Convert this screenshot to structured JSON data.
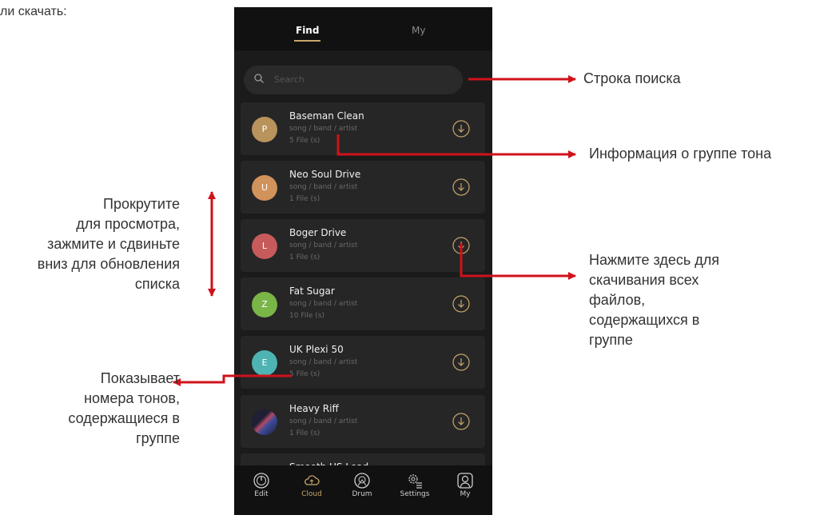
{
  "page_text": "ли скачать:",
  "tabs": {
    "find": "Find",
    "my": "My"
  },
  "search": {
    "placeholder": "Search"
  },
  "items": [
    {
      "initial": "P",
      "title": "Baseman Clean",
      "subtitle": "song / band / artist",
      "files": "5 File (s)",
      "color": "#b9935c"
    },
    {
      "initial": "U",
      "title": "Neo Soul Drive",
      "subtitle": "song / band / artist",
      "files": "1 File (s)",
      "color": "#d2925b"
    },
    {
      "initial": "L",
      "title": "Boger Drive",
      "subtitle": "song / band / artist",
      "files": "1 File (s)",
      "color": "#c75a5a"
    },
    {
      "initial": "Z",
      "title": "Fat Sugar",
      "subtitle": "song / band / artist",
      "files": "10 File (s)",
      "color": "#7ab548"
    },
    {
      "initial": "E",
      "title": "UK Plexi 50",
      "subtitle": "song / band / artist",
      "files": "5 File (s)",
      "color": "#4db3b3"
    },
    {
      "initial": "",
      "title": "Heavy Riff",
      "subtitle": "song / band / artist",
      "files": "1 File (s)",
      "color": "#22223a"
    },
    {
      "initial": "",
      "title": "Smooth US Lead",
      "subtitle": "",
      "files": "",
      "color": "#222222"
    }
  ],
  "nav": [
    {
      "label": "Edit",
      "icon": "edit-icon"
    },
    {
      "label": "Cloud",
      "icon": "cloud-icon"
    },
    {
      "label": "Drum",
      "icon": "drum-icon"
    },
    {
      "label": "Settings",
      "icon": "settings-icon"
    },
    {
      "label": "My",
      "icon": "user-icon"
    }
  ],
  "annotations": {
    "search_bar": "Строка поиска",
    "group_info": "Информация о группе тона",
    "download_all": [
      "Нажмите здесь для",
      "скачивания всех",
      "файлов,",
      "содержащихся в",
      "группе"
    ],
    "scroll": [
      "Прокрутите",
      "для просмотра,",
      "зажмите и сдвиньте",
      "вниз для обновления",
      "списка"
    ],
    "tone_count": [
      "Показывает",
      "номера тонов,",
      "содержащиеся в",
      "группе"
    ]
  },
  "colors": {
    "accent": "#c9a66b",
    "arrow": "#d0121b",
    "background": "#1b1b1b"
  }
}
